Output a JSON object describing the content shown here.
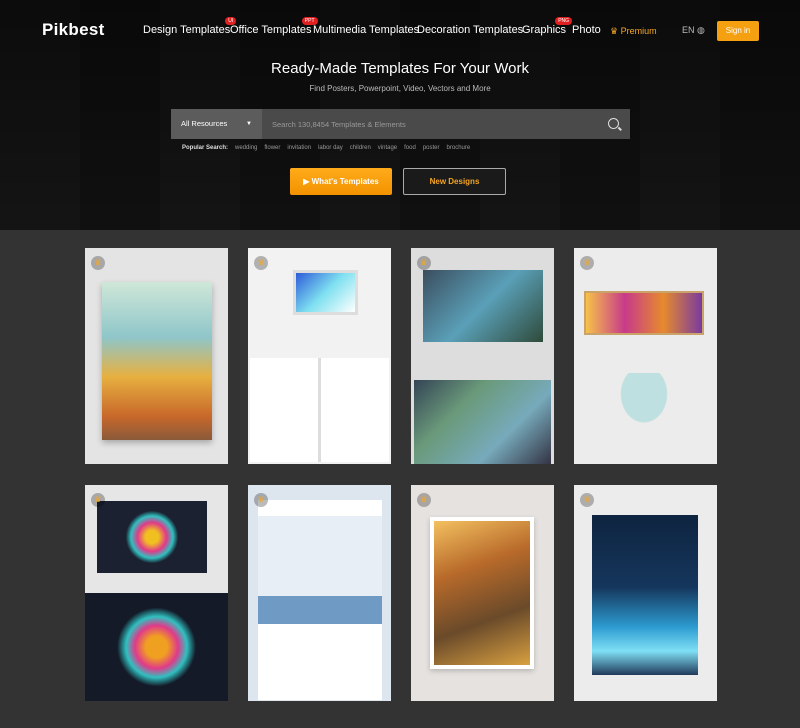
{
  "nav": {
    "logo": "Pikbest",
    "items": [
      {
        "label": "Design Templates",
        "badge": "UI"
      },
      {
        "label": "Office Templates",
        "badge": "PPT"
      },
      {
        "label": "Multimedia Templates"
      },
      {
        "label": "Decoration Templates"
      },
      {
        "label": "Graphics",
        "badge": "PNG"
      },
      {
        "label": "Photo"
      },
      {
        "label": "Premium"
      }
    ],
    "lang": "EN",
    "signin": "Sign in"
  },
  "hero": {
    "title": "Ready-Made Templates For Your Work",
    "subtitle": "Find Posters, Powerpoint, Video, Vectors and More",
    "search": {
      "category": "All Resources",
      "placeholder": "Search 130,8454 Templates & Elements"
    },
    "popular_label": "Popular Search:",
    "popular": [
      "wedding",
      "flower",
      "invitation",
      "labor day",
      "children",
      "vintage",
      "food",
      "poster",
      "brochure"
    ],
    "btn_primary": "What's Templates",
    "btn_secondary": "New Designs"
  },
  "colors": {
    "accent": "#f5a623",
    "bg": "#333333"
  },
  "cards": [
    "poster-mockup",
    "business-plan-ppt",
    "landscape-collage",
    "decoration-painting",
    "tiger-tshirt",
    "fashion-store-web",
    "forest-painting",
    "night-sky-poster"
  ]
}
